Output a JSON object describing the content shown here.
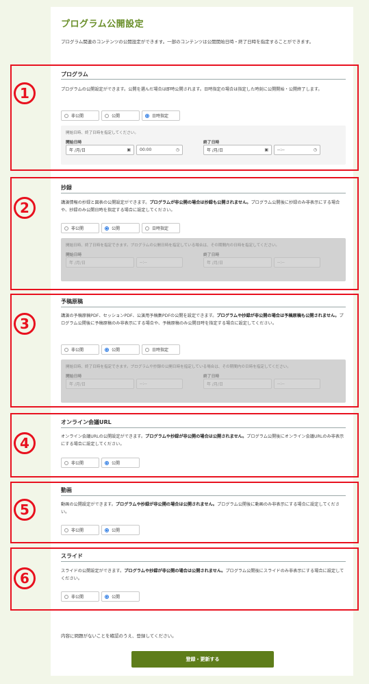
{
  "page": {
    "title": "プログラム公開設定",
    "intro": "プログラム関連のコンテンツの公開設定ができます。一部のコンテンツは公開開始日時・終了日時を指定することができます。"
  },
  "markers": [
    "1",
    "2",
    "3",
    "4",
    "5",
    "6"
  ],
  "program": {
    "title": "プログラム",
    "desc": "プログラムの公開設定ができます。公開を選んだ場合は即時公開されます。日時指定の場合は指定した時刻に公開開始・公開終了します。",
    "options": [
      "非公開",
      "公開",
      "日時指定"
    ],
    "selected": "日時指定",
    "date_note": "開始日時、終了日時を指定してください。",
    "start_label": "開始日時",
    "end_label": "終了日時",
    "start_date": "年 /月/日",
    "start_time": "00:00",
    "end_date": "年 /月/日",
    "end_time": "--:--"
  },
  "abstract": {
    "title": "抄録",
    "desc_a": "講演情報の抄録と図表の公開設定ができます。",
    "desc_b": "プログラムが非公開の場合は抄録も公開されません。",
    "desc_c": "プログラム公開後に抄録のみ非表示にする場合や、抄録のみ公開日時を指定する場合に設定してください。",
    "options": [
      "非公開",
      "公開",
      "日時指定"
    ],
    "selected": "公開",
    "date_note": "開始日時、終了日時を指定できます。プログラムの公開日時を指定している場合は、その期間内の日時を指定してください。",
    "start_label": "開始日時",
    "end_label": "終了日時",
    "start_date": "年 /月/日",
    "start_time": "--:--",
    "end_date": "年 /月/日",
    "end_time": "--:--"
  },
  "preprint": {
    "title": "予稿原稿",
    "desc_a": "講演の予稿原稿PDF、セッションPDF、公演用予稿集PDFの公開を設定できます。",
    "desc_b": "プログラムや抄録が非公開の場合は予稿原稿も公開されません。",
    "desc_c": "プログラム公開後に予稿原稿のみ非表示にする場合や、予稿原稿のみ公開日時を指定する場合に設定してください。",
    "options": [
      "非公開",
      "公開",
      "日時指定"
    ],
    "selected": "公開",
    "date_note": "開始日時、終了日時を指定できます。プログラムや抄録の公開日時を指定している場合は、その期間内の日時を指定してください。",
    "start_label": "開始日時",
    "end_label": "終了日時",
    "start_date": "年 /月/日",
    "start_time": "--:--",
    "end_date": "年 /月/日",
    "end_time": "--:--"
  },
  "online": {
    "title": "オンライン会議URL",
    "desc_a": "オンライン会議URLの公開設定ができます。",
    "desc_b": "プログラムや抄録が非公開の場合は公開されません。",
    "desc_c": "プログラム公開後にオンライン会議URLのみ非表示にする場合に設定してください。",
    "options": [
      "非公開",
      "公開"
    ],
    "selected": "公開"
  },
  "video": {
    "title": "動画",
    "desc_a": "動画の公開設定ができます。",
    "desc_b": "プログラムや抄録が非公開の場合は公開されません。",
    "desc_c": "プログラム公開後に動画のみ非表示にする場合に設定してください。",
    "options": [
      "非公開",
      "公開"
    ],
    "selected": "公開"
  },
  "slide": {
    "title": "スライド",
    "desc_a": "スライドの公開設定ができます。",
    "desc_b": "プログラムや抄録が非公開の場合は公開されません。",
    "desc_c": "プログラム公開後にスライドのみ非表示にする場合に設定してください。",
    "options": [
      "非公開",
      "公開"
    ],
    "selected": "公開"
  },
  "footer": {
    "note": "内容に問題がないことを確認のうえ、登録してください。",
    "submit_label": "登録・更新する"
  },
  "colors": {
    "accent": "#6a8f2a",
    "marker": "#e8101e",
    "submit": "#5e7d1a",
    "radio_selected": "#1a6fe0"
  }
}
